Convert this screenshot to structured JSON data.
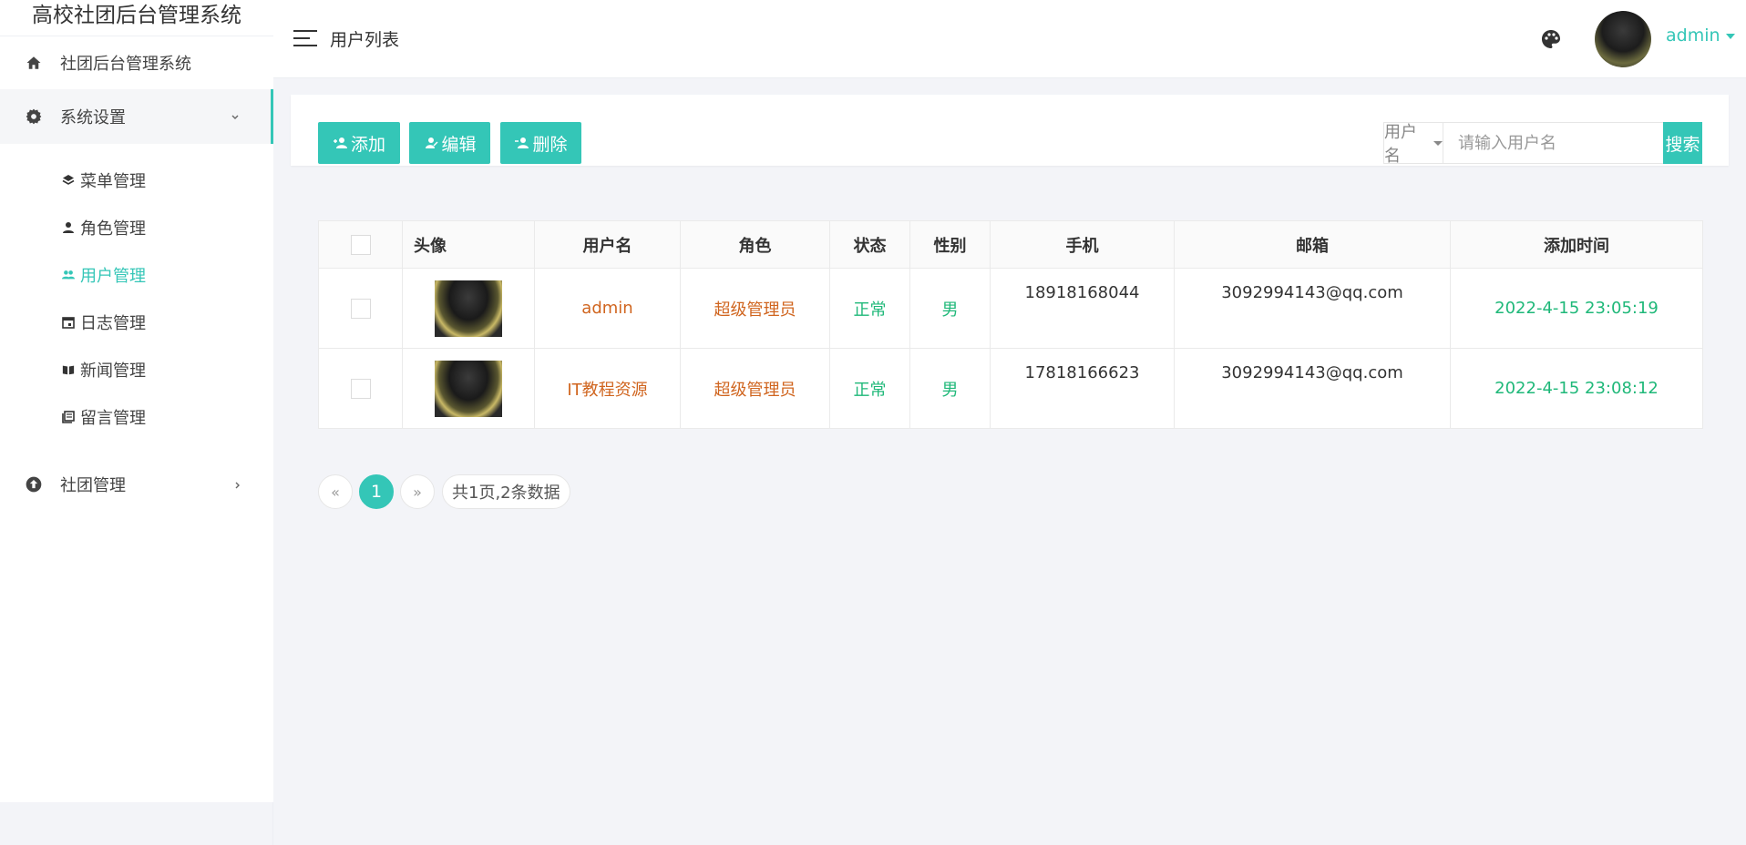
{
  "sidebar": {
    "brand": "高校社团后台管理系统",
    "items": [
      {
        "label": "社团后台管理系统",
        "icon": "home-icon"
      },
      {
        "label": "系统设置",
        "icon": "gear-icon",
        "expanded": true
      },
      {
        "label": "社团管理",
        "icon": "upload-circle-icon",
        "expanded": false
      }
    ],
    "sub_items": [
      {
        "label": "菜单管理",
        "icon": "layers-icon"
      },
      {
        "label": "角色管理",
        "icon": "person-icon"
      },
      {
        "label": "用户管理",
        "icon": "users-icon",
        "active": true
      },
      {
        "label": "日志管理",
        "icon": "calendar-icon"
      },
      {
        "label": "新闻管理",
        "icon": "book-icon"
      },
      {
        "label": "留言管理",
        "icon": "library-icon"
      }
    ]
  },
  "header": {
    "title": "用户列表",
    "user": "admin"
  },
  "toolbar": {
    "add": "添加",
    "edit": "编辑",
    "delete": "删除",
    "search_field": "用户名",
    "search_placeholder": "请输入用户名",
    "search_button": "搜索"
  },
  "table": {
    "columns": [
      "头像",
      "用户名",
      "角色",
      "状态",
      "性别",
      "手机",
      "邮箱",
      "添加时间"
    ],
    "rows": [
      {
        "username": "admin",
        "role": "超级管理员",
        "status": "正常",
        "gender": "男",
        "phone": "18918168044",
        "email": "3092994143@qq.com",
        "added": "2022-4-15 23:05:19"
      },
      {
        "username": "IT教程资源",
        "role": "超级管理员",
        "status": "正常",
        "gender": "男",
        "phone": "17818166623",
        "email": "3092994143@qq.com",
        "added": "2022-4-15 23:08:12"
      }
    ]
  },
  "pagination": {
    "prev": "«",
    "current": "1",
    "next": "»",
    "info": "共1页,2条数据"
  },
  "colors": {
    "accent": "#34c6b7",
    "orange": "#d0651f",
    "green": "#1fb879"
  }
}
